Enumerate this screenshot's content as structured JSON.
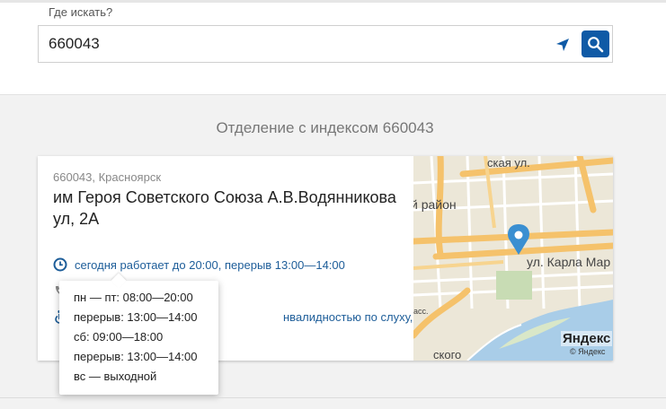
{
  "search": {
    "label": "Где искать?",
    "value": "660043",
    "geo_icon": "location-arrow-icon",
    "button_icon": "search-icon",
    "accent": "#0f5aa6"
  },
  "section": {
    "title": "Отделение с индексом 660043"
  },
  "office": {
    "location": "660043, Красноярск",
    "address": "им Героя Советского Союза А.В.Водянникова ул, 2А",
    "today_hours": "сегодня работает до 20:00, перерыв 13:00—14:00",
    "accessibility": "нвалидностью по слуху, зрению",
    "link_color": "#1d5d99"
  },
  "map": {
    "street_top": "ская ул.",
    "district": "й район",
    "street_main": "ул. Карла Мар",
    "label_left": "асс.",
    "label_bottom": "ского",
    "logo": "Яндекс",
    "copyright": "© Яндекс"
  },
  "schedule": {
    "lines": [
      "пн — пт: 08:00—20:00",
      "перерыв: 13:00—14:00",
      "сб: 09:00—18:00",
      "перерыв: 13:00—14:00",
      "вс — выходной"
    ]
  }
}
